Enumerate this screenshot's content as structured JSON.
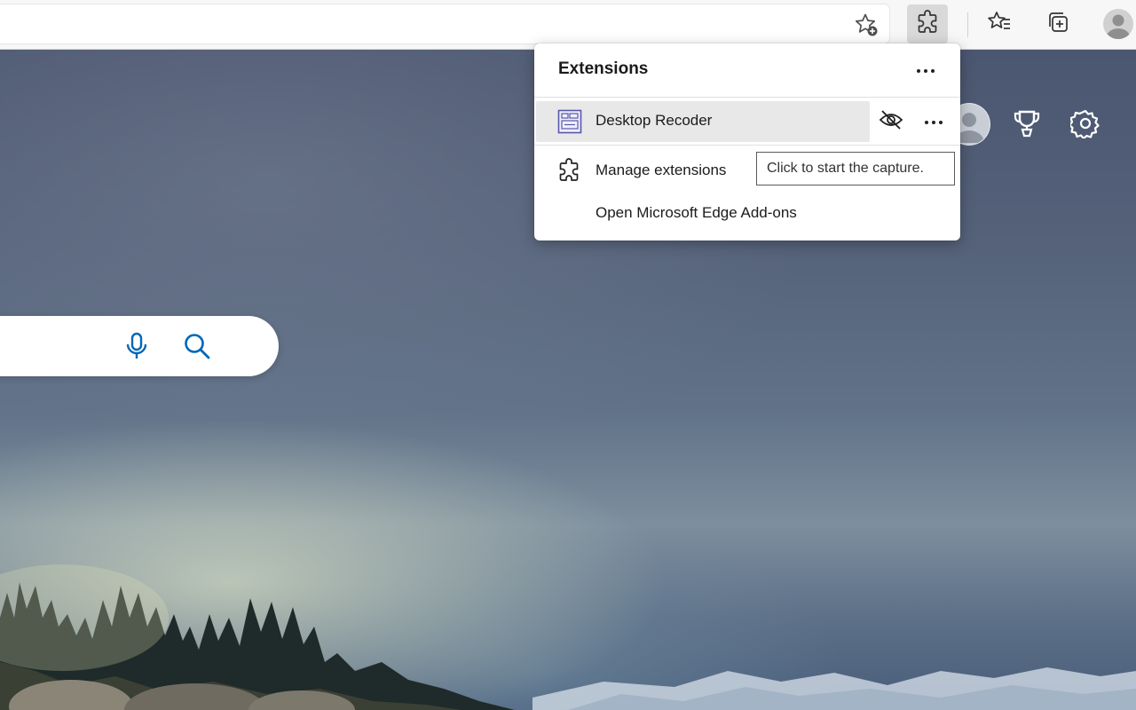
{
  "toolbar": {
    "add_favorite_icon": "star-add-icon",
    "extensions_icon": "puzzle-icon",
    "favorites_icon": "favorites-star-icon",
    "collections_icon": "collections-icon",
    "profile_icon": "profile-avatar"
  },
  "extensions_panel": {
    "title": "Extensions",
    "more_icon": "more-horizontal-icon",
    "items": [
      {
        "name": "Desktop Recoder",
        "icon": "desktop-recorder-icon",
        "visibility_icon": "eye-hidden-icon",
        "more_icon": "more-horizontal-icon"
      }
    ],
    "manage_label": "Manage extensions",
    "addons_label": "Open Microsoft Edge Add-ons"
  },
  "tooltip": {
    "text": "Click to start the capture."
  },
  "page": {
    "search_mic_icon": "microphone-icon",
    "search_icon": "search-icon",
    "rewards_icon": "trophy-icon",
    "settings_icon": "gear-icon"
  },
  "colors": {
    "accent": "#0067b8",
    "panel_bg": "#ffffff",
    "hover_row": "#e8e8e8",
    "toolbar_bg": "#f7f7f7"
  }
}
